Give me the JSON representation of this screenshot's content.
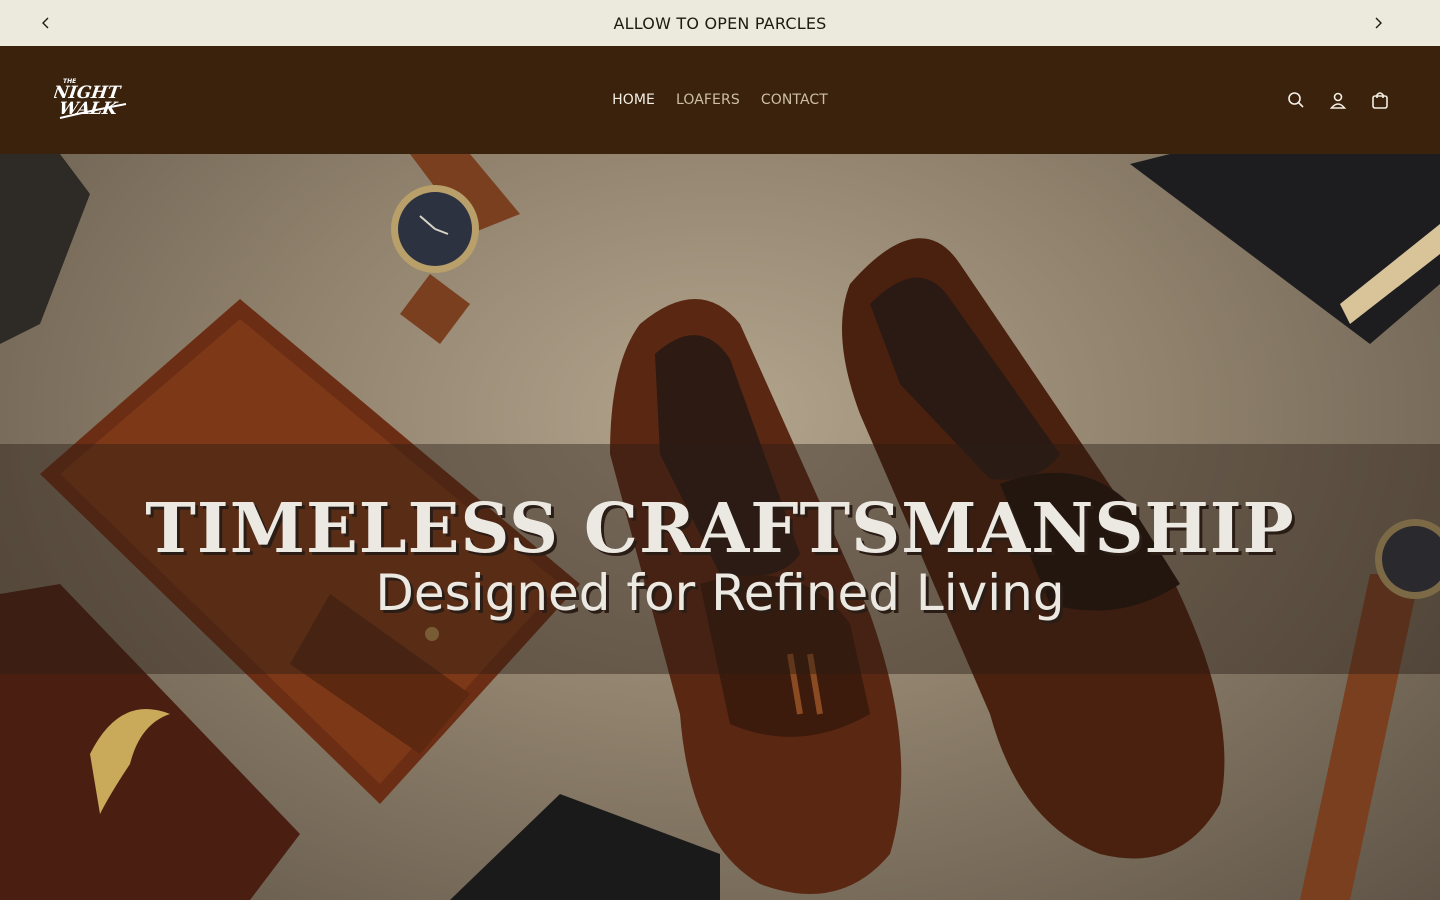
{
  "announcement": {
    "text": "ALLOW TO OPEN PARCLES",
    "prev_icon": "chevron-left-icon",
    "next_icon": "chevron-right-icon"
  },
  "header": {
    "logo": {
      "line1": "THE",
      "line2": "NIGHT",
      "line3": "WALK"
    },
    "nav": [
      {
        "label": "HOME",
        "active": true
      },
      {
        "label": "LOAFERS",
        "active": false
      },
      {
        "label": "CONTACT",
        "active": false
      }
    ],
    "icons": [
      "search-icon",
      "account-icon",
      "cart-icon"
    ]
  },
  "hero": {
    "headline": "TIMELESS CRAFTSMANSHIP",
    "subheadline": "Designed for Refined Living"
  },
  "colors": {
    "announcement_bg": "#ebeadc",
    "header_bg": "#3a220d",
    "nav_active": "#f4efe4",
    "nav_inactive": "#cdbfa6"
  }
}
